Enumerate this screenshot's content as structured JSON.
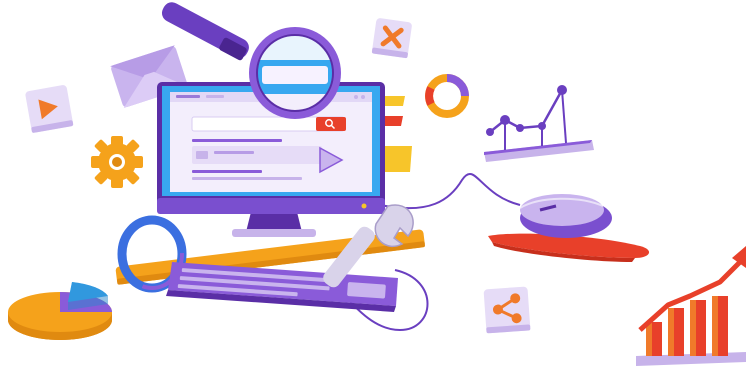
{
  "illustration": {
    "subject": "seo-web-development",
    "colors": {
      "purple": "#8a5bd9",
      "purple_dark": "#5a2ea6",
      "lavender": "#e6dcf7",
      "blue": "#38a8f0",
      "orange": "#f5a21b",
      "red": "#e8402a",
      "yellow": "#f7c52a",
      "white": "#ffffff"
    },
    "icons": [
      "play-card-icon",
      "envelope-icon",
      "gear-icon",
      "magnifier-icon",
      "close-card-icon",
      "ring-chart-icon",
      "line-chart-icon",
      "monitor-icon",
      "computer-mouse-icon",
      "keyboard-icon",
      "wrench-icon",
      "pie-chart-icon",
      "share-card-icon",
      "bar-chart-growth-icon"
    ]
  }
}
